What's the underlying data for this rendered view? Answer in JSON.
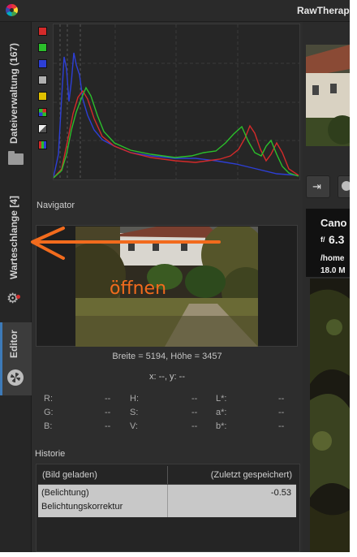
{
  "app": {
    "title": "RawTherapee"
  },
  "sidebar": {
    "tabs": [
      {
        "label": "Dateiverwaltung (167)"
      },
      {
        "label": "Warteschlange [4]"
      },
      {
        "label": "Editor"
      }
    ]
  },
  "histogram": {
    "channels": [
      {
        "name": "red",
        "color": "#d42a2a"
      },
      {
        "name": "green",
        "color": "#2bbf2b"
      },
      {
        "name": "blue",
        "color": "#2d3fd6"
      }
    ],
    "toggles": [
      "red-channel",
      "green-channel",
      "blue-channel",
      "luminance",
      "chroma",
      "bayer-raw",
      "linear-log",
      "rgb-bars"
    ]
  },
  "navigator": {
    "title": "Navigator",
    "size_label": "Breite = 5194, Höhe = 3457",
    "coords_label": "x: --, y: --",
    "values": [
      {
        "label": "R:",
        "value": "--"
      },
      {
        "label": "H:",
        "value": "--"
      },
      {
        "label": "L*:",
        "value": "--"
      },
      {
        "label": "G:",
        "value": "--"
      },
      {
        "label": "S:",
        "value": "--"
      },
      {
        "label": "a*:",
        "value": "--"
      },
      {
        "label": "B:",
        "value": "--"
      },
      {
        "label": "V:",
        "value": "--"
      },
      {
        "label": "b*:",
        "value": "--"
      }
    ]
  },
  "history": {
    "title": "Historie",
    "header": {
      "action": "(Bild geladen)",
      "value": "(Zuletzt gespeichert)"
    },
    "rows": [
      {
        "action_line1": "(Belichtung)",
        "action_line2": "Belichtungskorrektur",
        "value": "-0.53"
      }
    ]
  },
  "annotation": {
    "text": "öffnen",
    "color": "#f26b1d"
  },
  "info": {
    "camera": "Cano",
    "aperture_prefix": "f/",
    "aperture": "6.3",
    "path": "/home",
    "focal": "18.0 M"
  }
}
